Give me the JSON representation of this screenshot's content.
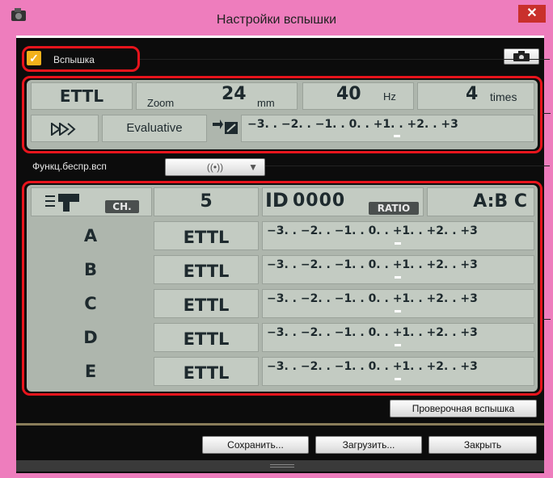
{
  "window": {
    "title": "Настройки вспышки",
    "close_glyph": "✕"
  },
  "flash": {
    "checkbox_label": "Вспышка",
    "checked": true,
    "mode": "ETTL",
    "zoom_label": "Zoom",
    "zoom_value": "24",
    "zoom_unit": "mm",
    "hz_value": "40",
    "hz_unit": "Hz",
    "times_value": "4",
    "times_unit": "times",
    "metering": "Evaluative",
    "exposure_scale": "−3. . −2. . −1. . 0. . +1. . +2. . +3"
  },
  "wireless": {
    "func_label": "Функц.беспр.всп",
    "func_value": "((•))",
    "ch_label": "CH.",
    "channel": "5",
    "id_label": "ID",
    "id_value": "0000",
    "ratio_label": "RATIO",
    "ratio_value": "A:B C",
    "groups": [
      {
        "letter": "A",
        "mode": "ETTL",
        "scale": "−3. . −2. . −1. . 0. . +1. . +2. . +3"
      },
      {
        "letter": "B",
        "mode": "ETTL",
        "scale": "−3. . −2. . −1. . 0. . +1. . +2. . +3"
      },
      {
        "letter": "C",
        "mode": "ETTL",
        "scale": "−3. . −2. . −1. . 0. . +1. . +2. . +3"
      },
      {
        "letter": "D",
        "mode": "ETTL",
        "scale": "−3. . −2. . −1. . 0. . +1. . +2. . +3"
      },
      {
        "letter": "E",
        "mode": "ETTL",
        "scale": "−3. . −2. . −1. . 0. . +1. . +2. . +3"
      }
    ]
  },
  "buttons": {
    "test_flash": "Проверочная вспышка",
    "save": "Сохранить...",
    "load": "Загрузить...",
    "close": "Закрыть"
  },
  "colors": {
    "accent_red": "#e8141c",
    "title_pink": "#ee7dbd",
    "lcd": "#aeb6ad",
    "checkbox": "#f3b21b"
  },
  "icons": [
    "app-icon",
    "camera-settings-icon",
    "flash-direction-icon",
    "flash-exposure-comp-icon",
    "fast-forward-icon",
    "wireless-flash-icon",
    "chevron-down-icon"
  ]
}
